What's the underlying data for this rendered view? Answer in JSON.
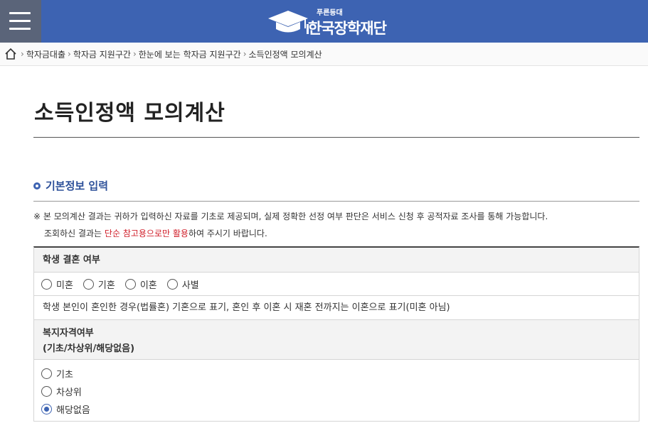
{
  "header": {
    "logo_main": "한국장학재단",
    "logo_sub": "푸른등대"
  },
  "breadcrumb": {
    "items": [
      "학자금대출",
      "학자금 지원구간",
      "한눈에 보는 학자금 지원구간",
      "소득인정액 모의계산"
    ]
  },
  "page": {
    "title": "소득인정액 모의계산"
  },
  "section": {
    "title": "기본정보 입력"
  },
  "notice": {
    "line1": "※ 본 모의계산 결과는 귀하가 입력하신 자료를 기초로 제공되며, 실제 정확한 선정 여부 판단은 서비스 신청 후 공적자료 조사를 통해 가능합니다.",
    "line2_pre": "조회하신 결과는 ",
    "line2_red": "단순 참고용으로만 활용",
    "line2_post": "하여 주시기 바랍니다."
  },
  "form": {
    "marriage": {
      "label": "학생 결혼 여부",
      "options": [
        "미혼",
        "기혼",
        "이혼",
        "사별"
      ],
      "selected": null,
      "description": "학생 본인이 혼인한 경우(법률혼) 기혼으로 표기, 혼인 후 이혼 시 재혼 전까지는 이혼으로 표기(미혼 아님)"
    },
    "welfare": {
      "label_line1": "복지자격여부",
      "label_line2": "(기초/차상위/해당없음)",
      "options": [
        "기초",
        "차상위",
        "해당없음"
      ],
      "selected": "해당없음"
    }
  },
  "colors": {
    "header_bg": "#3d63b2",
    "menu_bg": "#5a6479",
    "accent": "#3d63b2",
    "warning_text": "#d0202b"
  }
}
